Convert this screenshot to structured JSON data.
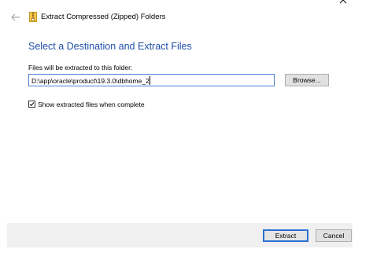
{
  "window": {
    "title": "Extract Compressed (Zipped) Folders",
    "close_glyph": "✕"
  },
  "main": {
    "heading": "Select a Destination and Extract Files",
    "path_label": "Files will be extracted to this folder:",
    "path_value": "D:\\app\\oracle\\product\\19.3.0\\dbhome_2",
    "browse_label": "Browse...",
    "show_files_label": "Show extracted files when complete",
    "show_files_checked": true
  },
  "footer": {
    "extract_label": "Extract",
    "cancel_label": "Cancel"
  },
  "colors": {
    "heading": "#1f4fa8",
    "accent": "#2b6fd1",
    "footer_bg": "#f0f0f0"
  },
  "icons": {
    "back": "back-arrow-icon",
    "zip": "zip-folder-icon",
    "close": "close-icon",
    "check": "checkmark-icon"
  }
}
